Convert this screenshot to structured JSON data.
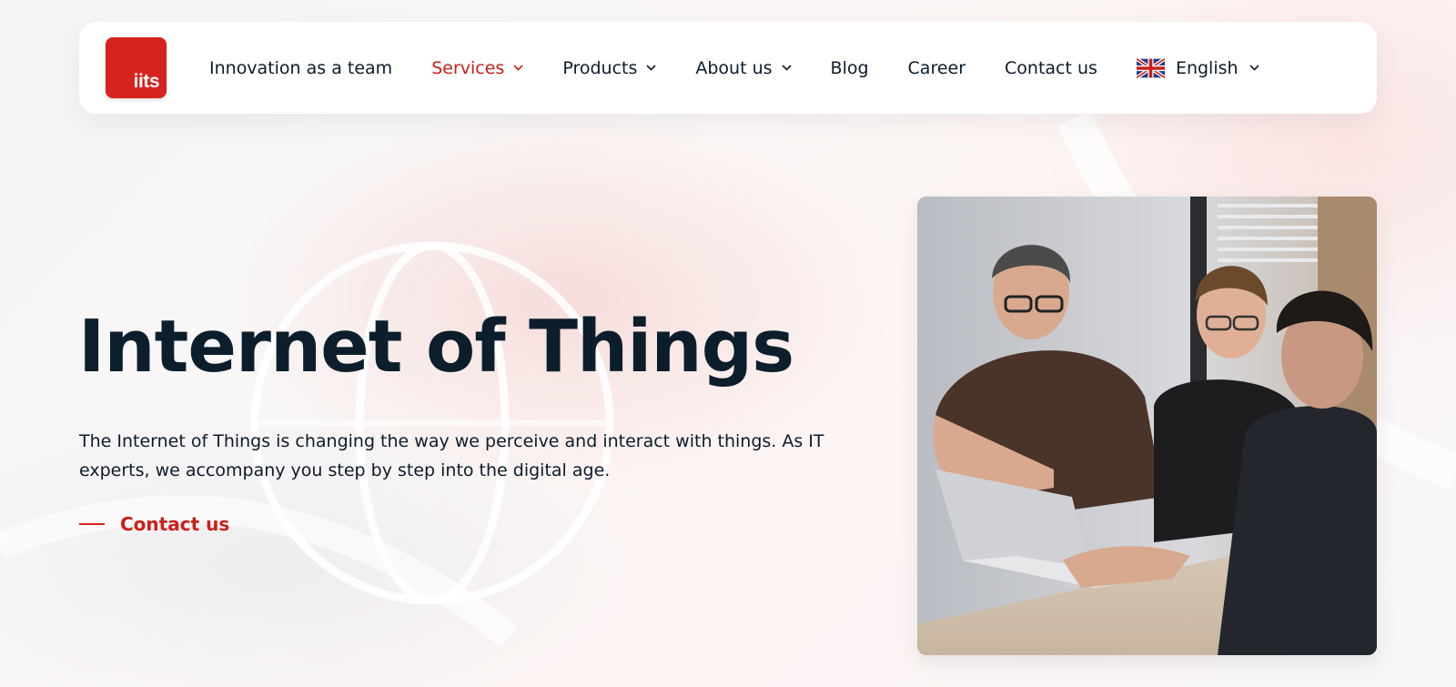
{
  "header": {
    "logo_text": "iits",
    "nav": [
      {
        "label": "Innovation as a team",
        "dropdown": false,
        "active": false
      },
      {
        "label": "Services",
        "dropdown": true,
        "active": true
      },
      {
        "label": "Products",
        "dropdown": true,
        "active": false
      },
      {
        "label": "About us",
        "dropdown": true,
        "active": false
      },
      {
        "label": "Blog",
        "dropdown": false,
        "active": false
      },
      {
        "label": "Career",
        "dropdown": false,
        "active": false
      },
      {
        "label": "Contact us",
        "dropdown": false,
        "active": false
      }
    ],
    "language": {
      "label": "English",
      "icon": "uk-flag-icon"
    }
  },
  "hero": {
    "title": "Internet of Things",
    "description": "The Internet of Things is changing the way we perceive and interact with things. As IT experts, we accompany you step by step into the digital age.",
    "cta_label": "Contact us",
    "image_subject": "three men working together at a laptop"
  },
  "colors": {
    "brand_red": "#d6231d",
    "active_nav": "#c8201a",
    "heading": "#0c1e2c",
    "text": "#0d1b2a"
  }
}
